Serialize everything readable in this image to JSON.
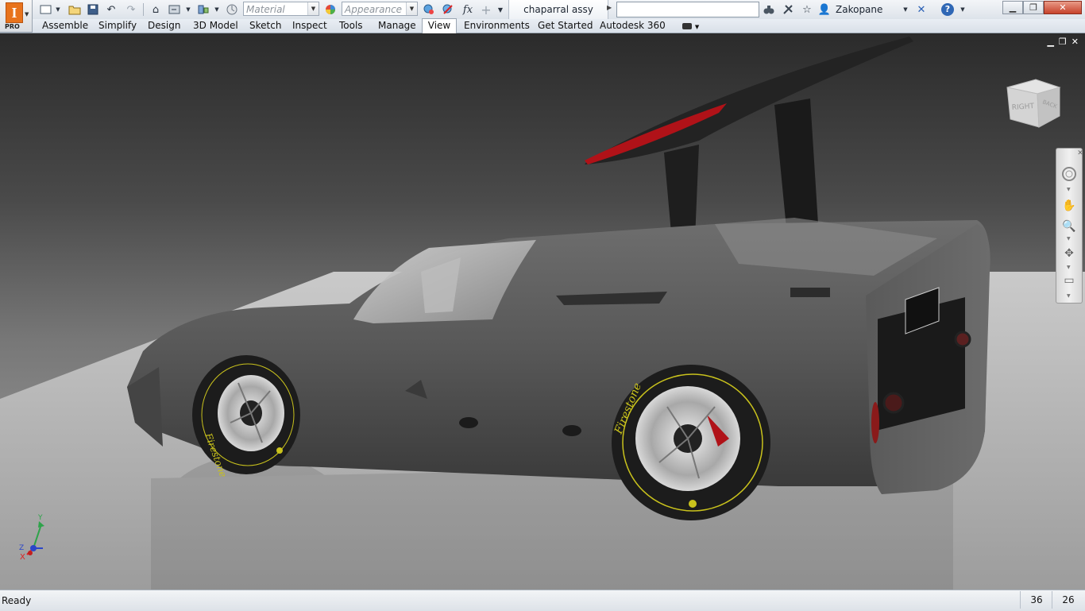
{
  "app": {
    "edition_badge": "PRO",
    "logo_letter": "I"
  },
  "quick_access": {
    "material_placeholder": "Material",
    "appearance_placeholder": "Appearance",
    "formula_label": "fx"
  },
  "document": {
    "tab_title": "chaparral assy"
  },
  "header": {
    "search_value": "",
    "user_name": "Zakopane",
    "help_label": "?"
  },
  "ribbon": {
    "tabs": [
      {
        "label": "Assemble"
      },
      {
        "label": "Simplify"
      },
      {
        "label": "Design"
      },
      {
        "label": "3D Model"
      },
      {
        "label": "Sketch"
      },
      {
        "label": "Inspect"
      },
      {
        "label": "Tools"
      },
      {
        "label": "Manage"
      },
      {
        "label": "View"
      },
      {
        "label": "Environments"
      },
      {
        "label": "Get Started"
      },
      {
        "label": "Autodesk 360"
      }
    ],
    "active_tab": "View"
  },
  "viewcube": {
    "face_right": "RIGHT",
    "face_back": "BACK"
  },
  "triad": {
    "x_label": "X",
    "y_label": "Y",
    "z_label": "Z"
  },
  "model": {
    "tire_brand": "Firestone"
  },
  "statusbar": {
    "status": "Ready",
    "count_a": "36",
    "count_b": "26"
  },
  "colors": {
    "accent_orange": "#e8731c",
    "wing_red": "#b01218",
    "tire_yellow": "#c9c21c"
  }
}
